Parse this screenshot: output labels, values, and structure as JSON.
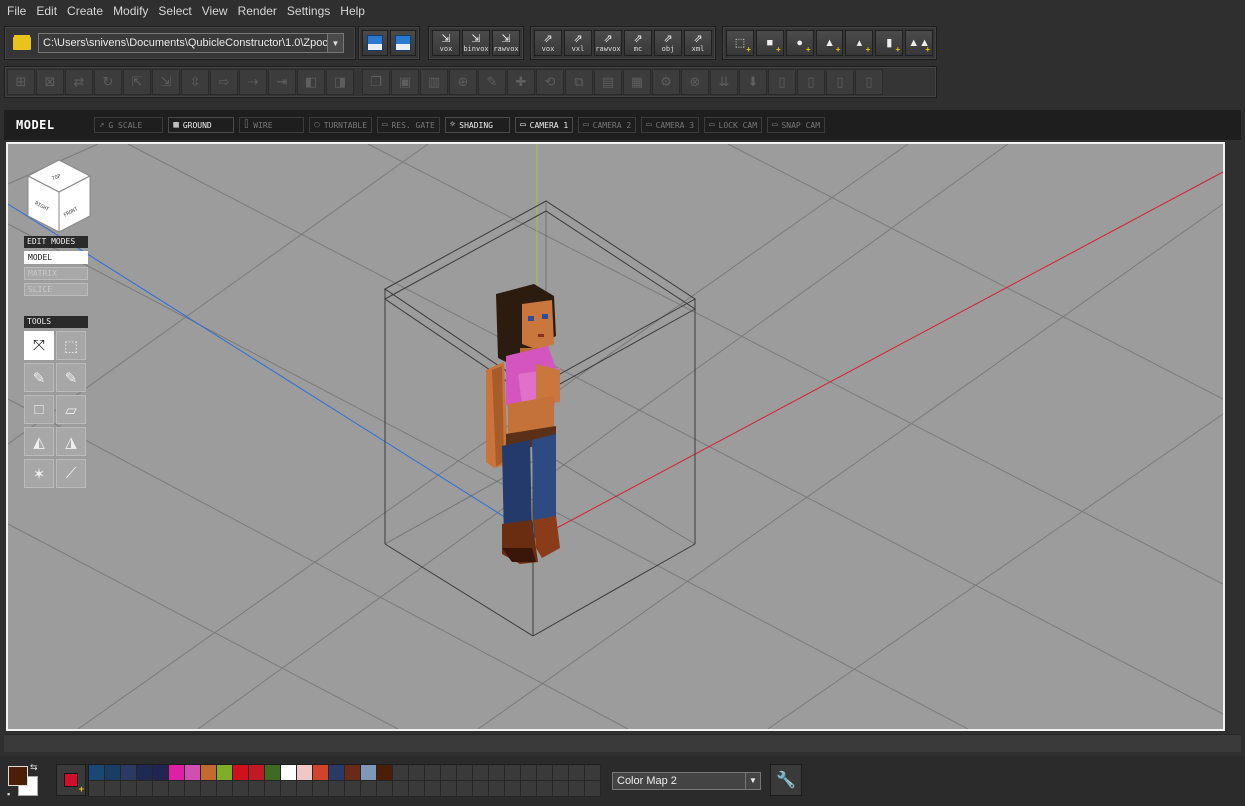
{
  "menu": [
    "File",
    "Edit",
    "Create",
    "Modify",
    "Select",
    "View",
    "Render",
    "Settings",
    "Help"
  ],
  "toolbar": {
    "file_path": "C:\\Users\\snivens\\Documents\\QubicleConstructor\\1.0\\Zpoc",
    "import_buttons": [
      "vox",
      "binvox",
      "rawvox"
    ],
    "export_buttons": [
      "vox",
      "vxl",
      "rawvox",
      "mc",
      "obj",
      "xml"
    ],
    "primitive_icons": [
      "cube-outline-icon",
      "cube-icon",
      "sphere-icon",
      "pyramid-icon",
      "cone-icon",
      "cylinder-icon",
      "terrain-icon"
    ]
  },
  "viewport": {
    "title": "MODEL",
    "buttons": [
      {
        "label": "G SCALE",
        "icon": "↗",
        "active": false
      },
      {
        "label": "GROUND",
        "icon": "▦",
        "active": true
      },
      {
        "label": "WIRE",
        "icon": "⌷",
        "active": false
      },
      {
        "label": "TURNTABLE",
        "icon": "○",
        "active": false
      },
      {
        "label": "RES. GATE",
        "icon": "▭",
        "active": false
      },
      {
        "label": "SHADING",
        "icon": "☼",
        "active": true
      },
      {
        "label": "CAMERA 1",
        "icon": "▭",
        "active": true
      },
      {
        "label": "CAMERA 2",
        "icon": "▭",
        "active": false
      },
      {
        "label": "CAMERA 3",
        "icon": "▭",
        "active": false
      },
      {
        "label": "LOCK CAM",
        "icon": "▭",
        "active": false
      },
      {
        "label": "SNAP CAM",
        "icon": "▭",
        "active": false
      }
    ],
    "nav_cube": {
      "top": "TOP",
      "right": "RIGHT",
      "front": "FRONT"
    }
  },
  "edit_modes": {
    "title": "EDIT MODES",
    "items": [
      "MODEL",
      "MATRIX",
      "SLICE"
    ],
    "active": "MODEL"
  },
  "tools": {
    "title": "TOOLS"
  },
  "colors": {
    "foreground": "#4b1e08",
    "background": "#ffffff",
    "current": "#d0102a",
    "palette": [
      "#1b4872",
      "#1a3d66",
      "#2a3a62",
      "#1e2a52",
      "#202650",
      "#e01fa6",
      "#d24fb2",
      "#c56a2e",
      "#7fae28",
      "#d0101c",
      "#c11a24",
      "#3e6a24",
      "#ffffff",
      "#f0c7c7",
      "#d0442a",
      "#2a3a66",
      "#6a2a18",
      "#7f98b8",
      "#4b1e08"
    ],
    "color_map": "Color Map 2"
  }
}
